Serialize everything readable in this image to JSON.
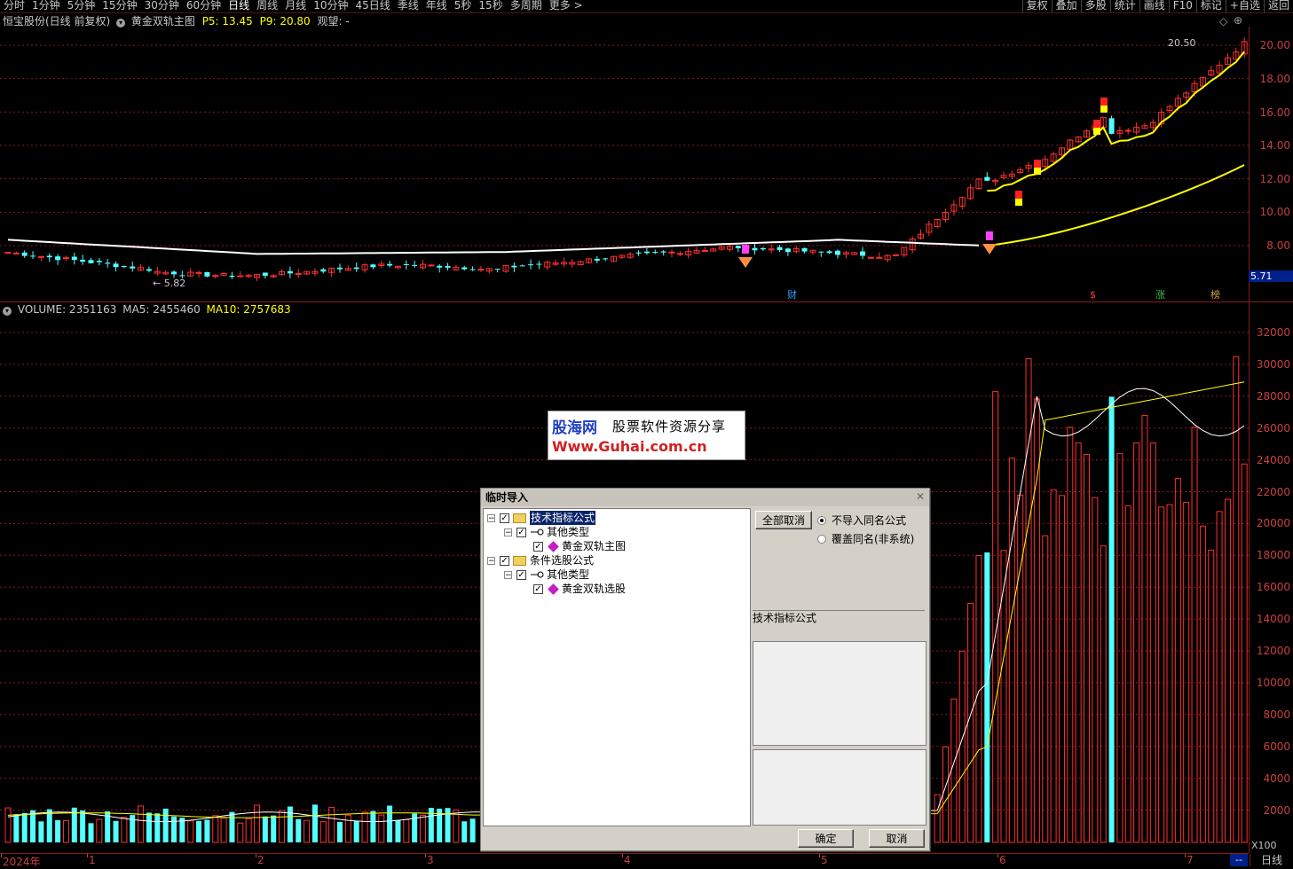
{
  "toolbar": {
    "periods": [
      "分时",
      "1分钟",
      "5分钟",
      "15分钟",
      "30分钟",
      "60分钟",
      "日线",
      "周线",
      "月线",
      "10分钟",
      "45日线",
      "季线",
      "年线",
      "5秒",
      "15秒",
      "多周期",
      "更多 >"
    ],
    "active_period": "日线",
    "tools": [
      "复权",
      "叠加",
      "多股",
      "统计",
      "画线",
      "F10",
      "标记",
      "+自选",
      "返回"
    ]
  },
  "main_chart": {
    "stock_label": "恒宝股份(日线 前复权)",
    "indicator_name": "黄金双轨主图",
    "p5_text": "P5: 13.45",
    "p9_text": "P9: 20.80",
    "view_text": "观望: -",
    "high_label": "20.50",
    "low_label": "5.82",
    "price_ticks": [
      "20.00",
      "18.00",
      "16.00",
      "14.00",
      "12.00",
      "10.00",
      "8.00"
    ],
    "price_box": "5.71",
    "markers": [
      {
        "text": "财",
        "color": "#30a0ff"
      },
      {
        "text": "$",
        "color": "#ff4040"
      },
      {
        "text": "涨",
        "color": "#40c040"
      },
      {
        "text": "榜",
        "color": "#d0a040"
      }
    ]
  },
  "volume_chart": {
    "label": "VOLUME: 2351163",
    "ma5": "MA5: 2455460",
    "ma10": "MA10: 2757683",
    "ticks": [
      "32000",
      "30000",
      "28000",
      "26000",
      "24000",
      "22000",
      "20000",
      "18000",
      "16000",
      "14000",
      "12000",
      "10000",
      "8000",
      "6000",
      "4000",
      "2000"
    ],
    "unit": "X100"
  },
  "date_axis": {
    "labels": [
      "2024年",
      "1",
      "2",
      "3",
      "4",
      "5",
      "6",
      "7"
    ],
    "period_tab": "日线",
    "corner": "--"
  },
  "watermark": {
    "brand": "股海网",
    "tagline": "股票软件资源分享",
    "url": "Www.Guhai.com.cn"
  },
  "dialog": {
    "title": "临时导入",
    "tree": [
      {
        "label": "技术指标公式",
        "level": 0,
        "selected": true
      },
      {
        "label": "其他类型",
        "level": 1
      },
      {
        "label": "黄金双轨主图",
        "level": 2
      },
      {
        "label": "条件选股公式",
        "level": 0
      },
      {
        "label": "其他类型",
        "level": 1
      },
      {
        "label": "黄金双轨选股",
        "level": 2
      }
    ],
    "cancel_all_label": "全部取消",
    "radio_no_import": "不导入同名公式",
    "radio_overwrite": "覆盖同名(非系统)",
    "category_label": "技术指标公式",
    "ok_label": "确定",
    "cancel_label": "取消"
  },
  "colors": {
    "up": "#ff3030",
    "down": "#54ffff",
    "ma_white": "#ffffff",
    "ma_yellow": "#ffff00",
    "grid": "#8a1a1a"
  }
}
